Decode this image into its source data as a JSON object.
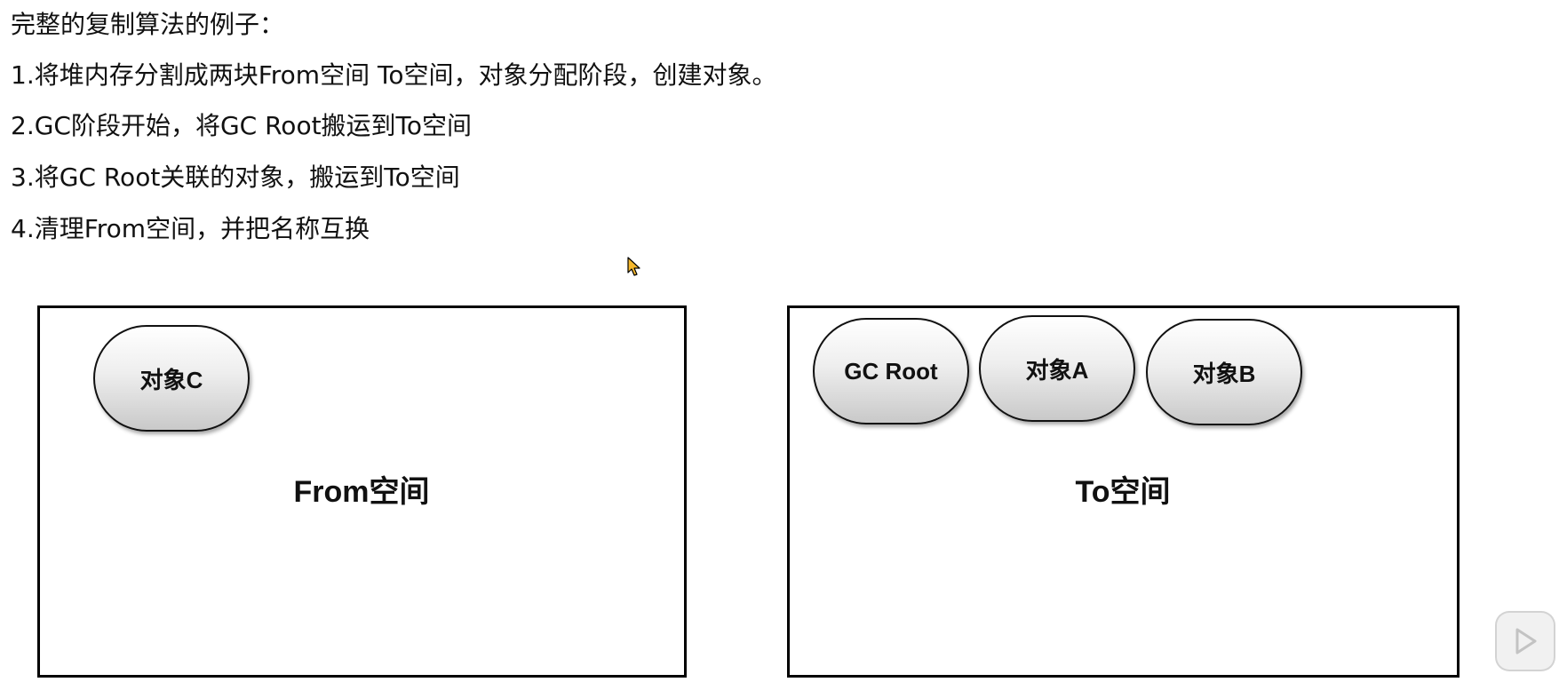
{
  "steps": [
    "完整的复制算法的例子：",
    "1.将堆内存分割成两块From空间 To空间，对象分配阶段，创建对象。",
    "2.GC阶段开始，将GC Root搬运到To空间",
    "3.将GC Root关联的对象，搬运到To空间",
    "4.清理From空间，并把名称互换"
  ],
  "from_space": {
    "label": "From空间",
    "objects": [
      "对象C"
    ]
  },
  "to_space": {
    "label": "To空间",
    "objects": [
      "GC Root",
      "对象A",
      "对象B"
    ]
  },
  "colors": {
    "box_border": "#000000",
    "node_gradient_top": "#ffffff",
    "node_gradient_bottom": "#c9c9c9",
    "cursor": "#f5b82e"
  },
  "icons": {
    "cursor": "mouse-pointer-icon",
    "play": "play-icon"
  }
}
